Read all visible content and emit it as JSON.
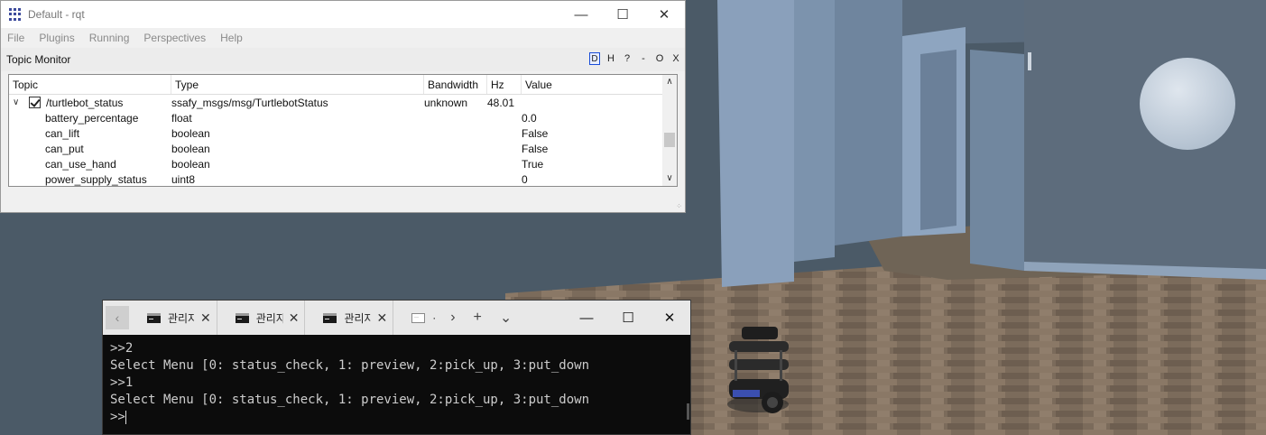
{
  "rqt": {
    "window_title": "Default - rqt",
    "menu": [
      "File",
      "Plugins",
      "Running",
      "Perspectives",
      "Help"
    ],
    "plugin_title": "Topic Monitor",
    "plugin_controls": [
      "D",
      "H",
      "?",
      "-",
      "O",
      "X"
    ],
    "columns": [
      "Topic",
      "Type",
      "Bandwidth",
      "Hz",
      "Value"
    ],
    "topic": {
      "name": "/turtlebot_status",
      "type": "ssafy_msgs/msg/TurtlebotStatus",
      "bandwidth": "unknown",
      "hz": "48.01",
      "checked": true
    },
    "fields": [
      {
        "name": "battery_percentage",
        "type": "float",
        "value": "0.0"
      },
      {
        "name": "can_lift",
        "type": "boolean",
        "value": "False"
      },
      {
        "name": "can_put",
        "type": "boolean",
        "value": "False"
      },
      {
        "name": "can_use_hand",
        "type": "boolean",
        "value": "True"
      },
      {
        "name": "power_supply_status",
        "type": "uint8",
        "value": "0"
      }
    ]
  },
  "terminal": {
    "tabs": [
      {
        "label": "관리자"
      },
      {
        "label": "관리자"
      },
      {
        "label": "관리자"
      },
      {
        "label": "·"
      }
    ],
    "lines": [
      ">>2",
      "Select Menu [0: status_check, 1: preview, 2:pick_up, 3:put_down",
      ">>1",
      "Select Menu [0: status_check, 1: preview, 2:pick_up, 3:put_down",
      ">>"
    ]
  },
  "colors": {
    "sky": "#4b5a67",
    "wall": "#7f98b4",
    "floor": "#7a6a5a",
    "terminal_bg": "#0c0c0c",
    "terminal_text": "#cccccc"
  }
}
